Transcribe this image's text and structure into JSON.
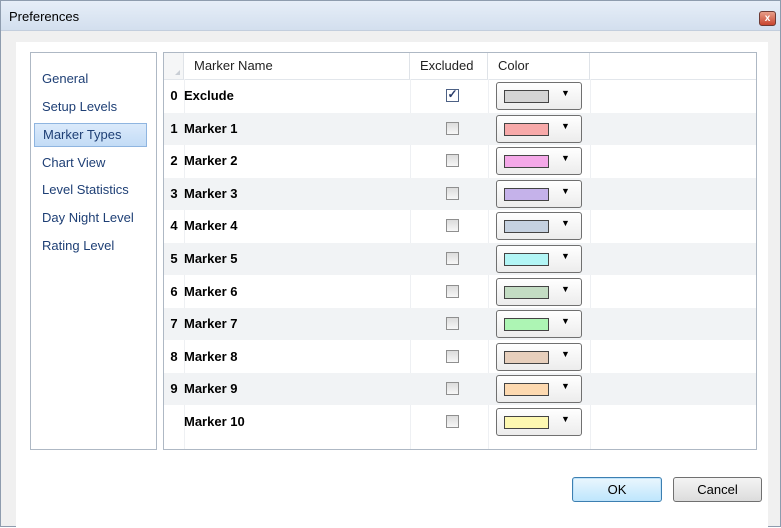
{
  "window": {
    "title": "Preferences",
    "close_label": "x"
  },
  "sidebar": {
    "items": [
      {
        "label": "General",
        "selected": false
      },
      {
        "label": "Setup Levels",
        "selected": false
      },
      {
        "label": "Marker Types",
        "selected": true
      },
      {
        "label": "Chart View",
        "selected": false
      },
      {
        "label": "Level Statistics",
        "selected": false
      },
      {
        "label": "Day Night Level",
        "selected": false
      },
      {
        "label": "Rating Level",
        "selected": false
      }
    ]
  },
  "grid": {
    "columns": {
      "name": "Marker Name",
      "excluded": "Excluded",
      "color": "Color"
    },
    "rows": [
      {
        "num": "0",
        "name": "Exclude",
        "excluded": true,
        "color": "#d4d4d4"
      },
      {
        "num": "1",
        "name": "Marker 1",
        "excluded": false,
        "color": "#f7a9a9"
      },
      {
        "num": "2",
        "name": "Marker 2",
        "excluded": false,
        "color": "#f4a8e8"
      },
      {
        "num": "3",
        "name": "Marker 3",
        "excluded": false,
        "color": "#c5b2ea"
      },
      {
        "num": "4",
        "name": "Marker 4",
        "excluded": false,
        "color": "#c5d1e0"
      },
      {
        "num": "5",
        "name": "Marker 5",
        "excluded": false,
        "color": "#b2f5f5"
      },
      {
        "num": "6",
        "name": "Marker 6",
        "excluded": false,
        "color": "#c3dcc3"
      },
      {
        "num": "7",
        "name": "Marker 7",
        "excluded": false,
        "color": "#adf5b4"
      },
      {
        "num": "8",
        "name": "Marker 8",
        "excluded": false,
        "color": "#e7cfbc"
      },
      {
        "num": "9",
        "name": "Marker 9",
        "excluded": false,
        "color": "#fdd9b0"
      },
      {
        "num": "",
        "name": "Marker 10",
        "excluded": false,
        "color": "#fdf8b1"
      }
    ]
  },
  "buttons": {
    "ok": "OK",
    "cancel": "Cancel"
  }
}
